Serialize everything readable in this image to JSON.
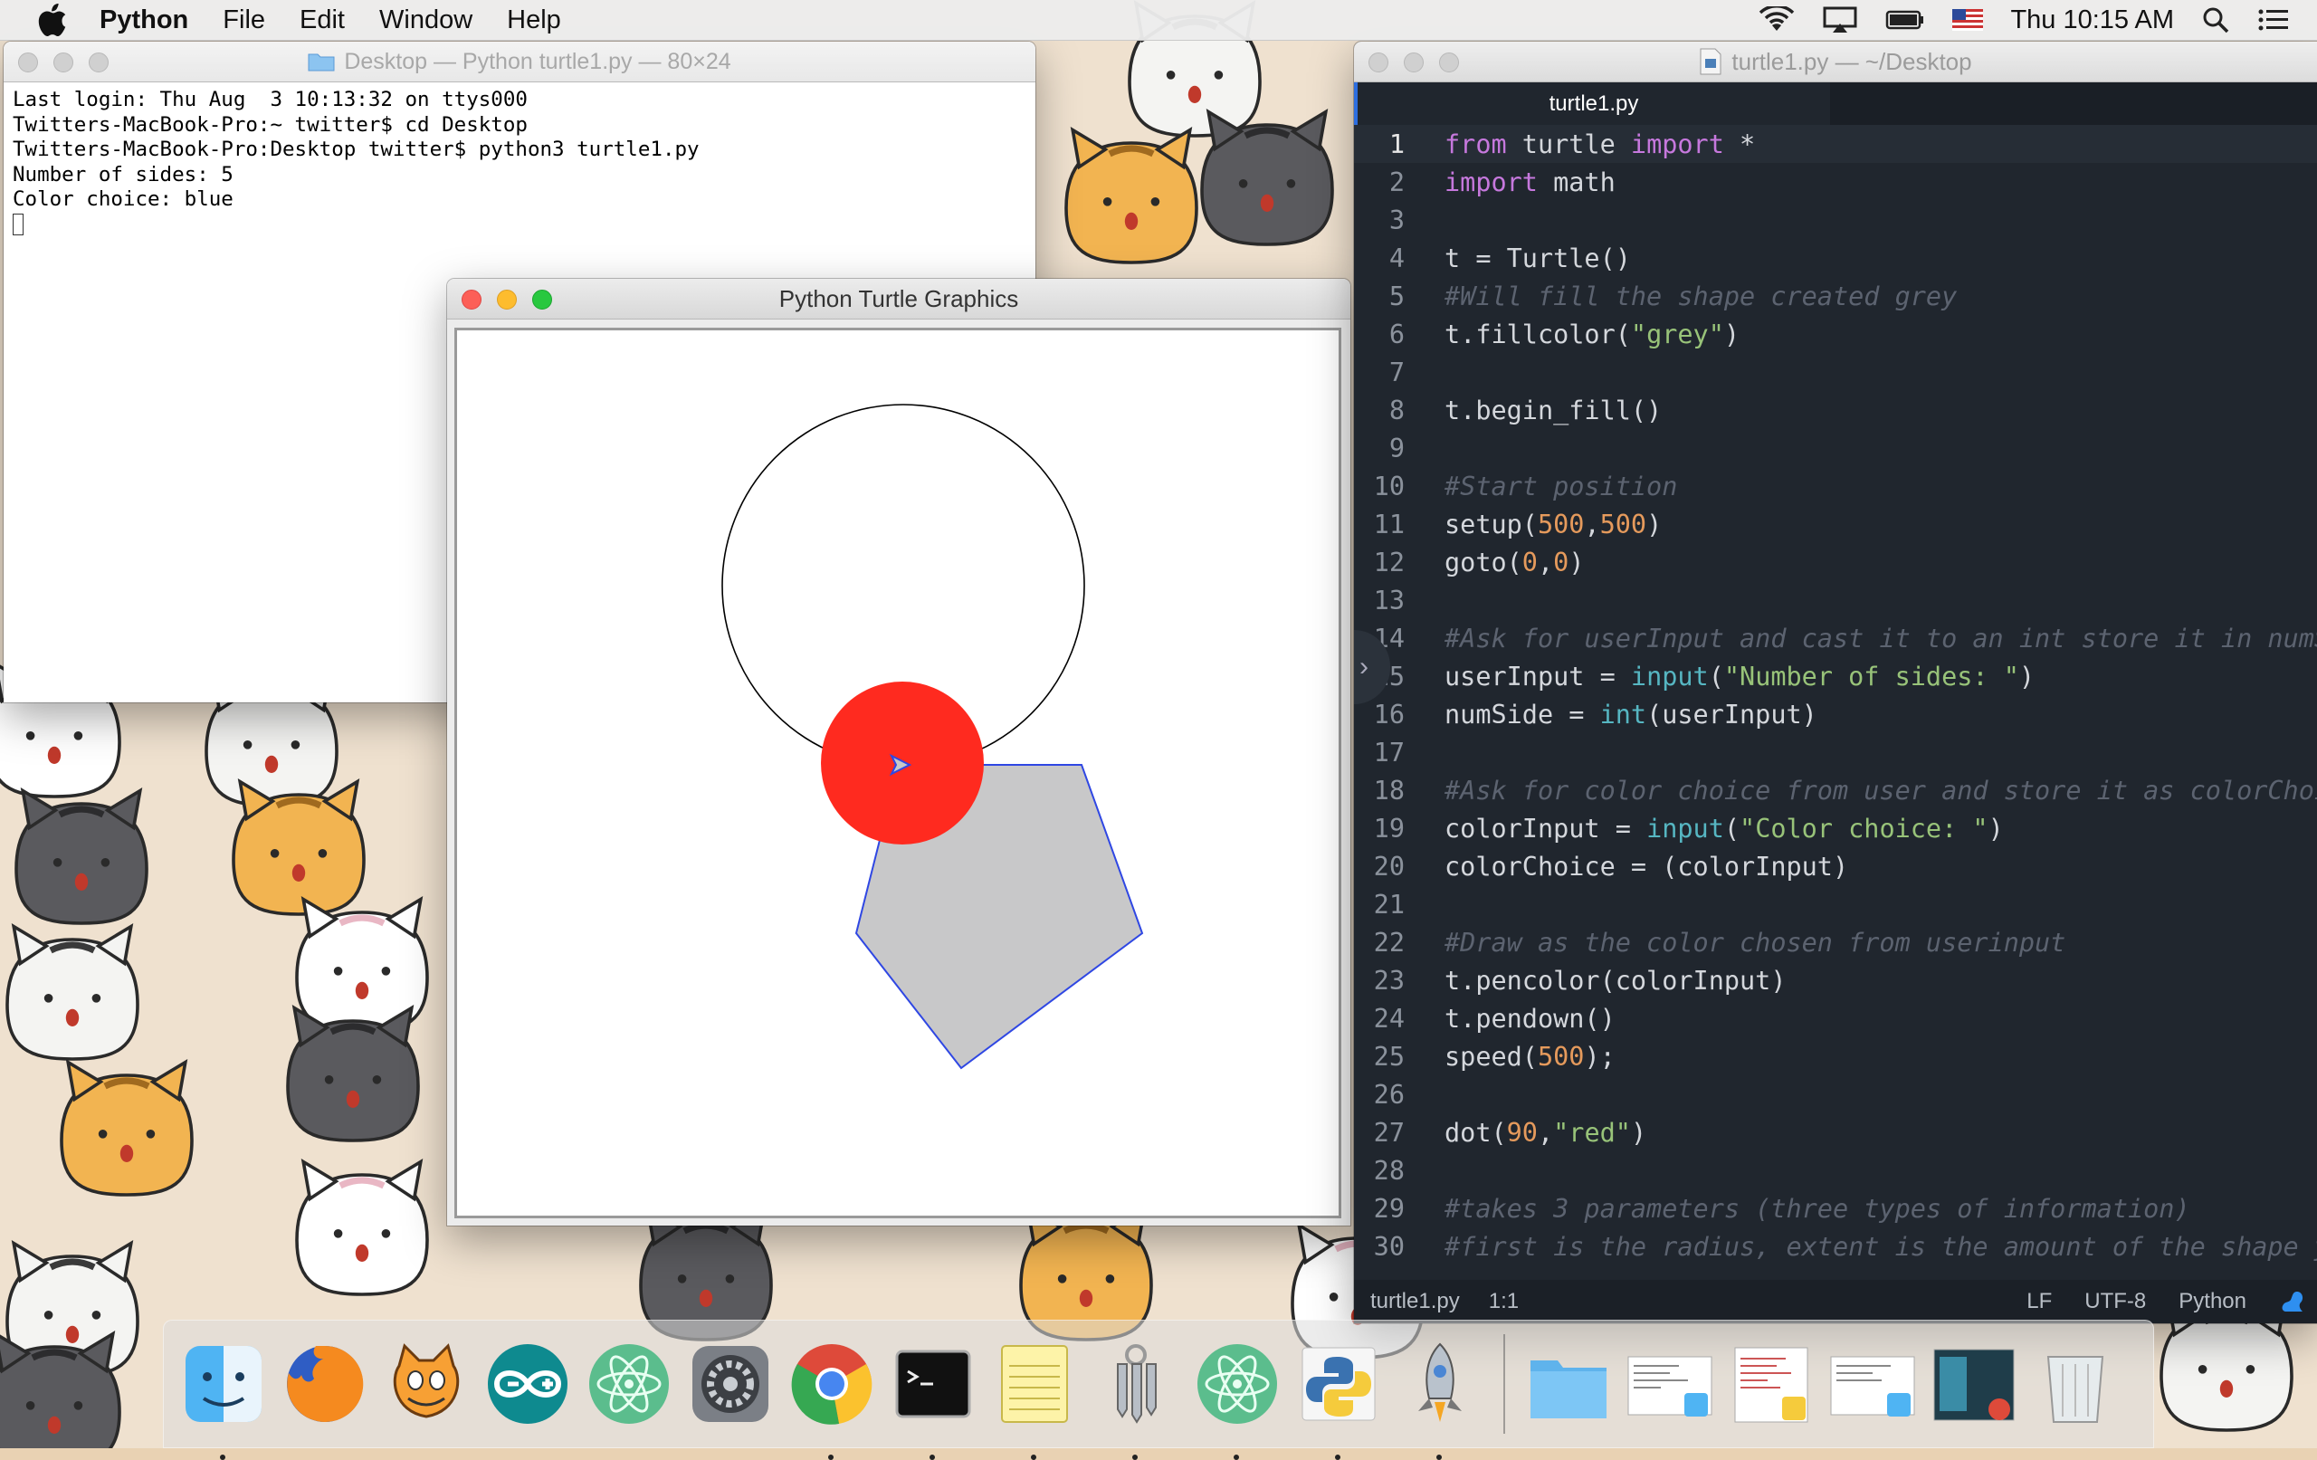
{
  "menubar": {
    "app_name": "Python",
    "items": [
      "File",
      "Edit",
      "Window",
      "Help"
    ],
    "clock": "Thu 10:15 AM"
  },
  "terminal": {
    "title": "Desktop — Python turtle1.py — 80×24",
    "lines": [
      "Last login: Thu Aug  3 10:13:32 on ttys000",
      "Twitters-MacBook-Pro:~ twitter$ cd Desktop",
      "Twitters-MacBook-Pro:Desktop twitter$ python3 turtle1.py",
      "Number of sides: 5",
      "Color choice: blue"
    ]
  },
  "turtle_window": {
    "title": "Python Turtle Graphics",
    "fill_color": "#c8c8c9",
    "pen_color": "#2f47e3",
    "dot_color": "#ff2a1f"
  },
  "editor": {
    "title": "turtle1.py — ~/Desktop",
    "tab_label": "turtle1.py",
    "status": {
      "file": "turtle1.py",
      "position": "1:1",
      "line_ending": "LF",
      "encoding": "UTF-8",
      "syntax": "Python"
    },
    "lines": [
      [
        [
          "kw",
          "from"
        ],
        [
          "txt",
          " turtle "
        ],
        [
          "kw",
          "import"
        ],
        [
          "txt",
          " *"
        ]
      ],
      [
        [
          "kw",
          "import"
        ],
        [
          "txt",
          " math"
        ]
      ],
      [],
      [
        [
          "txt",
          "t = Turtle()"
        ]
      ],
      [
        [
          "cm",
          "#Will fill the shape created grey"
        ]
      ],
      [
        [
          "txt",
          "t.fillcolor("
        ],
        [
          "str",
          "\"grey\""
        ],
        [
          "txt",
          ")"
        ]
      ],
      [],
      [
        [
          "txt",
          "t.begin_fill()"
        ]
      ],
      [],
      [
        [
          "cm",
          "#Start position"
        ]
      ],
      [
        [
          "txt",
          "setup("
        ],
        [
          "num",
          "500"
        ],
        [
          "txt",
          ","
        ],
        [
          "num",
          "500"
        ],
        [
          "txt",
          ")"
        ]
      ],
      [
        [
          "txt",
          "goto("
        ],
        [
          "num",
          "0"
        ],
        [
          "txt",
          ","
        ],
        [
          "num",
          "0"
        ],
        [
          "txt",
          ")"
        ]
      ],
      [],
      [
        [
          "cm",
          "#Ask for userInput and cast it to an int store it in numSi"
        ]
      ],
      [
        [
          "txt",
          "userInput = "
        ],
        [
          "fn",
          "input"
        ],
        [
          "txt",
          "("
        ],
        [
          "str",
          "\"Number of sides: \""
        ],
        [
          "txt",
          ")"
        ]
      ],
      [
        [
          "txt",
          "numSide = "
        ],
        [
          "fn",
          "int"
        ],
        [
          "txt",
          "(userInput)"
        ]
      ],
      [],
      [
        [
          "cm",
          "#Ask for color choice from user and store it as colorChoic"
        ]
      ],
      [
        [
          "txt",
          "colorInput = "
        ],
        [
          "fn",
          "input"
        ],
        [
          "txt",
          "("
        ],
        [
          "str",
          "\"Color choice: \""
        ],
        [
          "txt",
          ")"
        ]
      ],
      [
        [
          "txt",
          "colorChoice = (colorInput)"
        ]
      ],
      [],
      [
        [
          "cm",
          "#Draw as the color chosen from userinput"
        ]
      ],
      [
        [
          "txt",
          "t.pencolor(colorInput)"
        ]
      ],
      [
        [
          "txt",
          "t.pendown()"
        ]
      ],
      [
        [
          "txt",
          "speed("
        ],
        [
          "num",
          "500"
        ],
        [
          "txt",
          ");"
        ]
      ],
      [],
      [
        [
          "txt",
          "dot("
        ],
        [
          "num",
          "90"
        ],
        [
          "txt",
          ","
        ],
        [
          "str",
          "\"red\""
        ],
        [
          "txt",
          ")"
        ]
      ],
      [],
      [
        [
          "cm",
          "#takes 3 parameters (three types of information)"
        ]
      ],
      [
        [
          "cm",
          "#first is the radius, extent is the amount of the shape yo"
        ]
      ]
    ]
  },
  "dock": {
    "items": [
      {
        "name": "finder-icon",
        "running": true
      },
      {
        "name": "firefox-icon",
        "running": false
      },
      {
        "name": "scratch-icon",
        "running": false
      },
      {
        "name": "arduino-icon",
        "running": false
      },
      {
        "name": "atom-icon",
        "running": false
      },
      {
        "name": "system-preferences-icon",
        "running": false
      },
      {
        "name": "chrome-icon",
        "running": true
      },
      {
        "name": "terminal-icon",
        "running": true
      },
      {
        "name": "notes-icon",
        "running": true
      },
      {
        "name": "keychain-icon",
        "running": true
      },
      {
        "name": "atom-icon",
        "running": true
      },
      {
        "name": "python-launcher-icon",
        "running": true
      },
      {
        "name": "rocket-icon",
        "running": true
      }
    ]
  }
}
